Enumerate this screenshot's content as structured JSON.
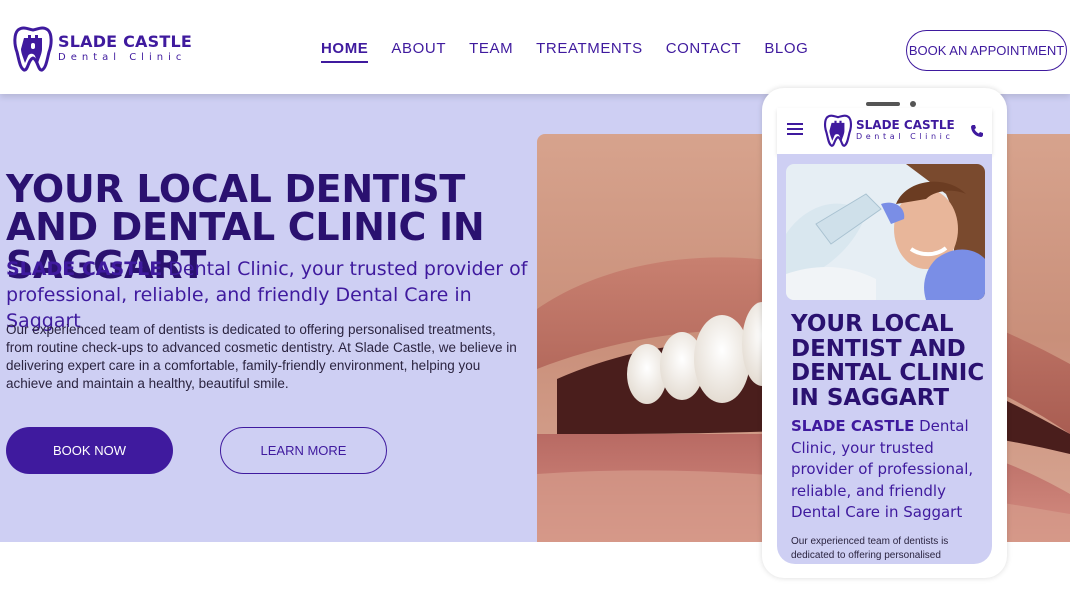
{
  "brand": {
    "name": "SLADE CASTLE",
    "tagline": "Dental Clinic",
    "color": "#3f1a9e",
    "hero_bg": "#cecff3"
  },
  "nav": {
    "items": [
      {
        "label": "HOME",
        "active": true
      },
      {
        "label": "ABOUT",
        "active": false
      },
      {
        "label": "TEAM",
        "active": false
      },
      {
        "label": "TREATMENTS",
        "active": false
      },
      {
        "label": "CONTACT",
        "active": false
      },
      {
        "label": "BLOG",
        "active": false
      }
    ],
    "cta": "BOOK AN APPOINTMENT"
  },
  "hero": {
    "title_part1": "YOUR ",
    "title_bold": "LOCAL DENTIST",
    "title_part2": " AND DENTAL CLINIC IN SAGGART",
    "sub_bold": "SLADE CASTLE",
    "sub_rest": " Dental Clinic, your trusted provider of professional, reliable, and friendly Dental Care in Saggart",
    "body": "Our experienced team of dentists is dedicated to offering personalised treatments, from routine check-ups to advanced cosmetic dentistry. At Slade Castle, we believe in delivering expert care in a comfortable, family-friendly environment, helping you achieve and maintain a healthy, beautiful smile.",
    "btn_primary": "BOOK NOW",
    "btn_secondary": "LEARN MORE"
  },
  "mobile": {
    "brand_name": "SLADE CASTLE",
    "brand_tagline": "Dental Clinic",
    "title_part1": "YOUR ",
    "title_bold1": "LOCAL DENTIST",
    "title_part2": " AND DENTAL CLINIC IN SAGGART",
    "sub_bold": "SLADE CASTLE",
    "sub_rest": " Dental Clinic, your trusted provider of professional, reliable, and friendly Dental Care in Saggart",
    "body": "Our experienced team of dentists is dedicated to offering personalised"
  },
  "icons": {
    "logo": "tooth-castle-icon",
    "menu": "hamburger-icon",
    "call": "phone-icon"
  }
}
